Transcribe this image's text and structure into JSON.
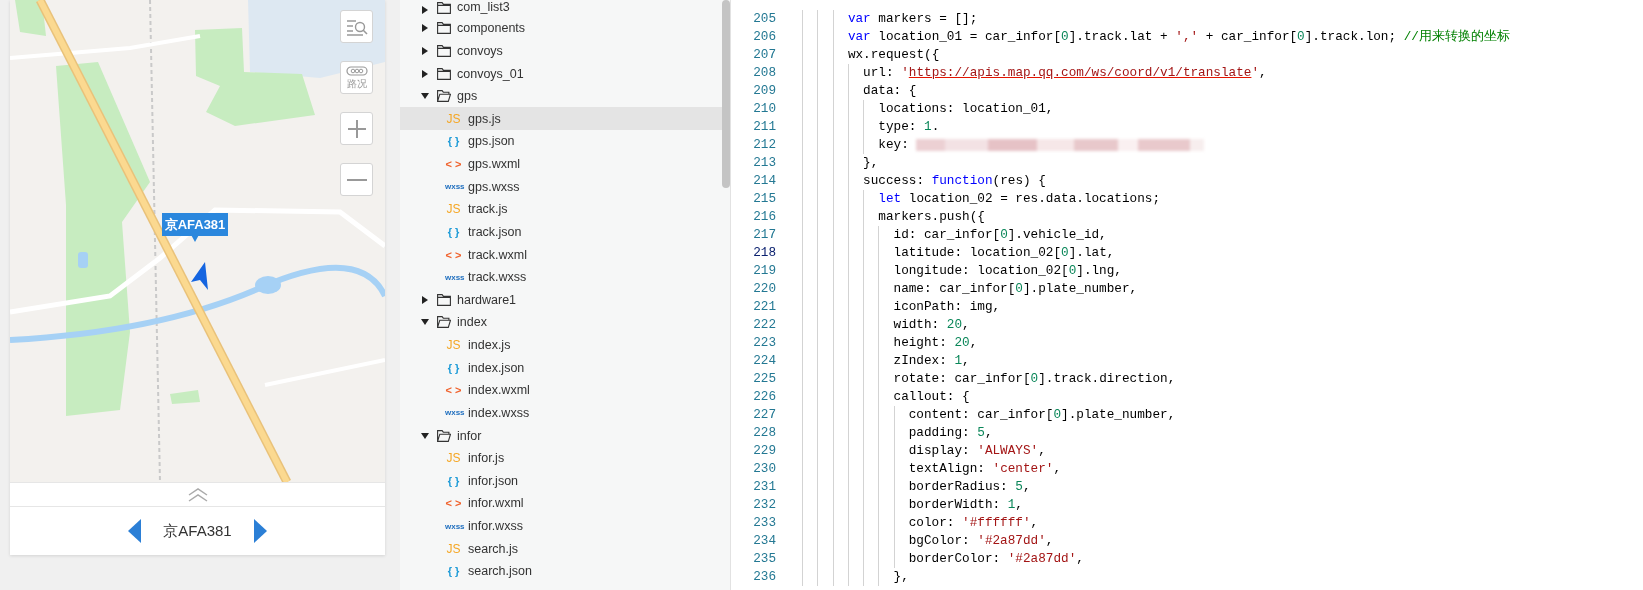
{
  "preview": {
    "map": {
      "controls": [
        {
          "kind": "search-list"
        },
        {
          "kind": "traffic",
          "label": "路况"
        },
        {
          "kind": "zoom-in"
        },
        {
          "kind": "zoom-out"
        }
      ],
      "callout": "京AFA381"
    },
    "bottom_bar": {
      "plate": "京AFA381"
    }
  },
  "file_tree": {
    "items": [
      {
        "name": "com_list3",
        "kind": "folder",
        "expanded": false,
        "selected": false
      },
      {
        "name": "components",
        "kind": "folder",
        "expanded": false,
        "selected": false
      },
      {
        "name": "convoys",
        "kind": "folder",
        "expanded": false,
        "selected": false
      },
      {
        "name": "convoys_01",
        "kind": "folder",
        "expanded": false,
        "selected": false
      },
      {
        "name": "gps",
        "kind": "folder",
        "expanded": true,
        "selected": false,
        "children": [
          {
            "name": "gps.js",
            "kind": "js",
            "icon": "JS",
            "selected": true
          },
          {
            "name": "gps.json",
            "kind": "json",
            "icon": "{ }",
            "selected": false
          },
          {
            "name": "gps.wxml",
            "kind": "wxml",
            "icon": "< >",
            "selected": false
          },
          {
            "name": "gps.wxss",
            "kind": "wxss",
            "icon": "wxss",
            "selected": false
          },
          {
            "name": "track.js",
            "kind": "js",
            "icon": "JS",
            "selected": false
          },
          {
            "name": "track.json",
            "kind": "json",
            "icon": "{ }",
            "selected": false
          },
          {
            "name": "track.wxml",
            "kind": "wxml",
            "icon": "< >",
            "selected": false
          },
          {
            "name": "track.wxss",
            "kind": "wxss",
            "icon": "wxss",
            "selected": false
          }
        ]
      },
      {
        "name": "hardware1",
        "kind": "folder",
        "expanded": false,
        "selected": false
      },
      {
        "name": "index",
        "kind": "folder",
        "expanded": true,
        "selected": false,
        "children": [
          {
            "name": "index.js",
            "kind": "js",
            "icon": "JS",
            "selected": false
          },
          {
            "name": "index.json",
            "kind": "json",
            "icon": "{ }",
            "selected": false
          },
          {
            "name": "index.wxml",
            "kind": "wxml",
            "icon": "< >",
            "selected": false
          },
          {
            "name": "index.wxss",
            "kind": "wxss",
            "icon": "wxss",
            "selected": false
          }
        ]
      },
      {
        "name": "infor",
        "kind": "folder",
        "expanded": true,
        "selected": false,
        "children": [
          {
            "name": "infor.js",
            "kind": "js",
            "icon": "JS",
            "selected": false
          },
          {
            "name": "infor.json",
            "kind": "json",
            "icon": "{ }",
            "selected": false
          },
          {
            "name": "infor.wxml",
            "kind": "wxml",
            "icon": "< >",
            "selected": false
          },
          {
            "name": "infor.wxss",
            "kind": "wxss",
            "icon": "wxss",
            "selected": false
          },
          {
            "name": "search.js",
            "kind": "js",
            "icon": "JS",
            "selected": false
          },
          {
            "name": "search.json",
            "kind": "json",
            "icon": "{ }",
            "selected": false
          }
        ]
      }
    ]
  },
  "editor": {
    "lines": [
      {
        "number": "205",
        "active": false,
        "blurred": false,
        "tokens": [
          {
            "kind": "kw",
            "text": "        var"
          },
          {
            "kind": "p",
            "text": " markers = [];"
          }
        ]
      },
      {
        "number": "206",
        "active": false,
        "blurred": false,
        "tokens": [
          {
            "kind": "kw",
            "text": "        var"
          },
          {
            "kind": "p",
            "text": " location_01 = car_infor["
          },
          {
            "kind": "num",
            "text": "0"
          },
          {
            "kind": "p",
            "text": "].track.lat + "
          },
          {
            "kind": "str",
            "text": "','"
          },
          {
            "kind": "p",
            "text": " + car_infor["
          },
          {
            "kind": "num",
            "text": "0"
          },
          {
            "kind": "p",
            "text": "].track.lon; "
          },
          {
            "kind": "cm",
            "text": "//用来转换的坐标"
          }
        ]
      },
      {
        "number": "207",
        "active": false,
        "blurred": false,
        "tokens": [
          {
            "kind": "p",
            "text": "        wx.request({"
          }
        ]
      },
      {
        "number": "208",
        "active": false,
        "blurred": false,
        "tokens": [
          {
            "kind": "p",
            "text": "          url: "
          },
          {
            "kind": "str",
            "text": "'"
          },
          {
            "kind": "url",
            "text": "https://apis.map.qq.com/ws/coord/v1/translate"
          },
          {
            "kind": "str",
            "text": "'"
          },
          {
            "kind": "p",
            "text": ","
          }
        ]
      },
      {
        "number": "209",
        "active": false,
        "blurred": false,
        "tokens": [
          {
            "kind": "p",
            "text": "          data: {"
          }
        ]
      },
      {
        "number": "210",
        "active": false,
        "blurred": false,
        "tokens": [
          {
            "kind": "p",
            "text": "            locations: location_01,"
          }
        ]
      },
      {
        "number": "211",
        "active": false,
        "blurred": false,
        "tokens": [
          {
            "kind": "p",
            "text": "            type: "
          },
          {
            "kind": "num",
            "text": "1"
          },
          {
            "kind": "p",
            "text": "."
          }
        ]
      },
      {
        "number": "212",
        "active": false,
        "blurred": true,
        "tokens": [
          {
            "kind": "p",
            "text": "            key:"
          }
        ]
      },
      {
        "number": "213",
        "active": false,
        "blurred": false,
        "tokens": [
          {
            "kind": "p",
            "text": "          },"
          }
        ]
      },
      {
        "number": "214",
        "active": false,
        "blurred": false,
        "tokens": [
          {
            "kind": "p",
            "text": "          success: "
          },
          {
            "kind": "kw",
            "text": "function"
          },
          {
            "kind": "p",
            "text": "(res) {"
          }
        ]
      },
      {
        "number": "215",
        "active": false,
        "blurred": false,
        "tokens": [
          {
            "kind": "kw",
            "text": "            let"
          },
          {
            "kind": "p",
            "text": " location_02 = res.data.locations;"
          }
        ]
      },
      {
        "number": "216",
        "active": false,
        "blurred": false,
        "tokens": [
          {
            "kind": "p",
            "text": "            markers.push({"
          }
        ]
      },
      {
        "number": "217",
        "active": false,
        "blurred": false,
        "tokens": [
          {
            "kind": "p",
            "text": "              id: car_infor["
          },
          {
            "kind": "num",
            "text": "0"
          },
          {
            "kind": "p",
            "text": "].vehicle_id,"
          }
        ]
      },
      {
        "number": "218",
        "active": true,
        "blurred": false,
        "tokens": [
          {
            "kind": "p",
            "text": "              latitude: location_02["
          },
          {
            "kind": "num",
            "text": "0"
          },
          {
            "kind": "p",
            "text": "].lat,"
          }
        ]
      },
      {
        "number": "219",
        "active": false,
        "blurred": false,
        "tokens": [
          {
            "kind": "p",
            "text": "              longitude: location_02["
          },
          {
            "kind": "num",
            "text": "0"
          },
          {
            "kind": "p",
            "text": "].lng,"
          }
        ]
      },
      {
        "number": "220",
        "active": false,
        "blurred": false,
        "tokens": [
          {
            "kind": "p",
            "text": "              name: car_infor["
          },
          {
            "kind": "num",
            "text": "0"
          },
          {
            "kind": "p",
            "text": "].plate_number,"
          }
        ]
      },
      {
        "number": "221",
        "active": false,
        "blurred": false,
        "tokens": [
          {
            "kind": "p",
            "text": "              iconPath: img,"
          }
        ]
      },
      {
        "number": "222",
        "active": false,
        "blurred": false,
        "tokens": [
          {
            "kind": "p",
            "text": "              width: "
          },
          {
            "kind": "num",
            "text": "20"
          },
          {
            "kind": "p",
            "text": ","
          }
        ]
      },
      {
        "number": "223",
        "active": false,
        "blurred": false,
        "tokens": [
          {
            "kind": "p",
            "text": "              height: "
          },
          {
            "kind": "num",
            "text": "20"
          },
          {
            "kind": "p",
            "text": ","
          }
        ]
      },
      {
        "number": "224",
        "active": false,
        "blurred": false,
        "tokens": [
          {
            "kind": "p",
            "text": "              zIndex: "
          },
          {
            "kind": "num",
            "text": "1"
          },
          {
            "kind": "p",
            "text": ","
          }
        ]
      },
      {
        "number": "225",
        "active": false,
        "blurred": false,
        "tokens": [
          {
            "kind": "p",
            "text": "              rotate: car_infor["
          },
          {
            "kind": "num",
            "text": "0"
          },
          {
            "kind": "p",
            "text": "].track.direction,"
          }
        ]
      },
      {
        "number": "226",
        "active": false,
        "blurred": false,
        "tokens": [
          {
            "kind": "p",
            "text": "              callout: {"
          }
        ]
      },
      {
        "number": "227",
        "active": false,
        "blurred": false,
        "tokens": [
          {
            "kind": "p",
            "text": "                content: car_infor["
          },
          {
            "kind": "num",
            "text": "0"
          },
          {
            "kind": "p",
            "text": "].plate_number,"
          }
        ]
      },
      {
        "number": "228",
        "active": false,
        "blurred": false,
        "tokens": [
          {
            "kind": "p",
            "text": "                padding: "
          },
          {
            "kind": "num",
            "text": "5"
          },
          {
            "kind": "p",
            "text": ","
          }
        ]
      },
      {
        "number": "229",
        "active": false,
        "blurred": false,
        "tokens": [
          {
            "kind": "p",
            "text": "                display: "
          },
          {
            "kind": "str",
            "text": "'ALWAYS'"
          },
          {
            "kind": "p",
            "text": ","
          }
        ]
      },
      {
        "number": "230",
        "active": false,
        "blurred": false,
        "tokens": [
          {
            "kind": "p",
            "text": "                textAlign: "
          },
          {
            "kind": "str",
            "text": "'center'"
          },
          {
            "kind": "p",
            "text": ","
          }
        ]
      },
      {
        "number": "231",
        "active": false,
        "blurred": false,
        "tokens": [
          {
            "kind": "p",
            "text": "                borderRadius: "
          },
          {
            "kind": "num",
            "text": "5"
          },
          {
            "kind": "p",
            "text": ","
          }
        ]
      },
      {
        "number": "232",
        "active": false,
        "blurred": false,
        "tokens": [
          {
            "kind": "p",
            "text": "                borderWidth: "
          },
          {
            "kind": "num",
            "text": "1"
          },
          {
            "kind": "p",
            "text": ","
          }
        ]
      },
      {
        "number": "233",
        "active": false,
        "blurred": false,
        "tokens": [
          {
            "kind": "p",
            "text": "                color: "
          },
          {
            "kind": "str",
            "text": "'#ffffff'"
          },
          {
            "kind": "p",
            "text": ","
          }
        ]
      },
      {
        "number": "234",
        "active": false,
        "blurred": false,
        "tokens": [
          {
            "kind": "p",
            "text": "                bgColor: "
          },
          {
            "kind": "str",
            "text": "'#2a87dd'"
          },
          {
            "kind": "p",
            "text": ","
          }
        ]
      },
      {
        "number": "235",
        "active": false,
        "blurred": false,
        "tokens": [
          {
            "kind": "p",
            "text": "                borderColor: "
          },
          {
            "kind": "str",
            "text": "'#2a87dd'"
          },
          {
            "kind": "p",
            "text": ","
          }
        ]
      },
      {
        "number": "236",
        "active": false,
        "blurred": false,
        "tokens": [
          {
            "kind": "p",
            "text": "              },"
          }
        ]
      }
    ]
  }
}
